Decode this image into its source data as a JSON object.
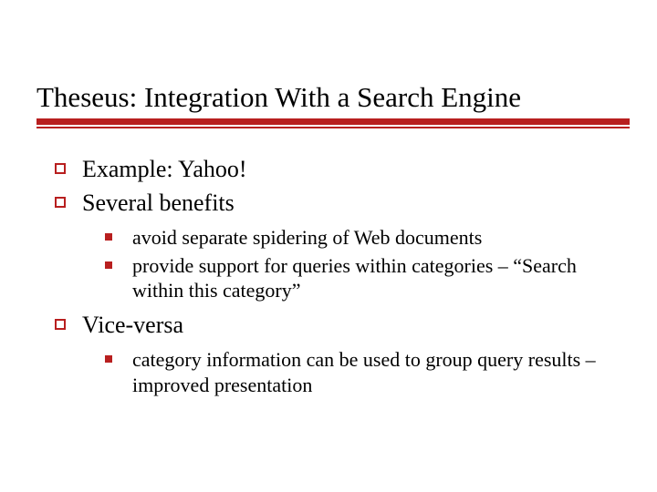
{
  "slide": {
    "title": "Theseus: Integration With a Search Engine",
    "items": [
      {
        "text": "Example: Yahoo!",
        "sub": []
      },
      {
        "text": "Several benefits",
        "sub": [
          {
            "text": "avoid separate spidering of Web documents"
          },
          {
            "text": "provide support for queries within categories – “Search within this category”"
          }
        ]
      },
      {
        "text": "Vice-versa",
        "sub": [
          {
            "text": "category information can be used to group query results – improved presentation"
          }
        ]
      }
    ]
  },
  "colors": {
    "accent": "#b81f1f"
  }
}
